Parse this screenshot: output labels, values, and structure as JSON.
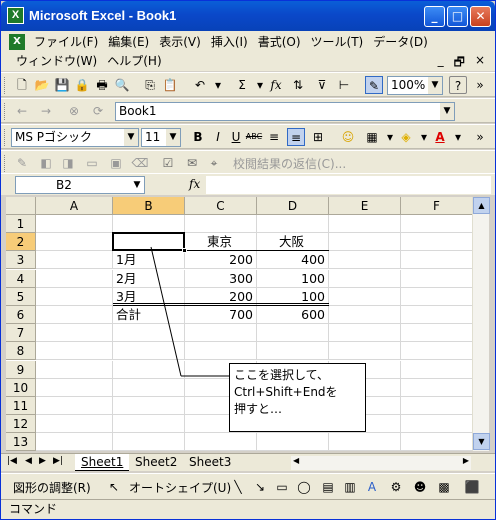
{
  "window": {
    "title": "Microsoft Excel - Book1",
    "app_icon_letter": "X",
    "minimize": "_",
    "maximize": "□",
    "close": "✕"
  },
  "menu": {
    "items": [
      "ファイル(F)",
      "編集(E)",
      "表示(V)",
      "挿入(I)",
      "書式(O)",
      "ツール(T)",
      "データ(D)"
    ],
    "items_row2": [
      "ウィンドウ(W)",
      "ヘルプ(H)"
    ],
    "doc_minimize": "_",
    "doc_restore": "🗗",
    "doc_close": "×"
  },
  "standard_toolbar": {
    "zoom": "100%",
    "sigma": "Σ",
    "fx": "fx",
    "help": "?"
  },
  "web_toolbar": {
    "address": "Book1"
  },
  "format_toolbar": {
    "font_name": "MS Pゴシック",
    "font_size": "11",
    "bold": "B",
    "italic": "I",
    "underline": "U",
    "abc": "ABC"
  },
  "review_toolbar": {
    "reply_label": "校閲結果の返信(C)..."
  },
  "formula_bar": {
    "name_box": "B2",
    "fx_label": "fx",
    "formula": ""
  },
  "grid": {
    "columns": [
      "A",
      "B",
      "C",
      "D",
      "E",
      "F"
    ],
    "rows": [
      "1",
      "2",
      "3",
      "4",
      "5",
      "6",
      "7",
      "8",
      "9",
      "10",
      "11",
      "12",
      "13"
    ],
    "selected_cell": "B2",
    "cells": {
      "C2": "東京",
      "D2": "大阪",
      "B3": "1月",
      "C3": "200",
      "D3": "400",
      "B4": "2月",
      "C4": "300",
      "D4": "100",
      "B5": "3月",
      "C5": "200",
      "D5": "100",
      "B6": "合計",
      "C6": "700",
      "D6": "600"
    }
  },
  "callout": {
    "line1": "ここを選択して、",
    "line2": "Ctrl+Shift+Endを",
    "line3": "押すと…"
  },
  "sheet_tabs": {
    "tabs": [
      "Sheet1",
      "Sheet2",
      "Sheet3"
    ],
    "active": "Sheet1"
  },
  "drawing_toolbar": {
    "draw_label": "図形の調整(R)",
    "autoshape_label": "オートシェイプ(U)"
  },
  "status_bar": {
    "text": "コマンド"
  }
}
